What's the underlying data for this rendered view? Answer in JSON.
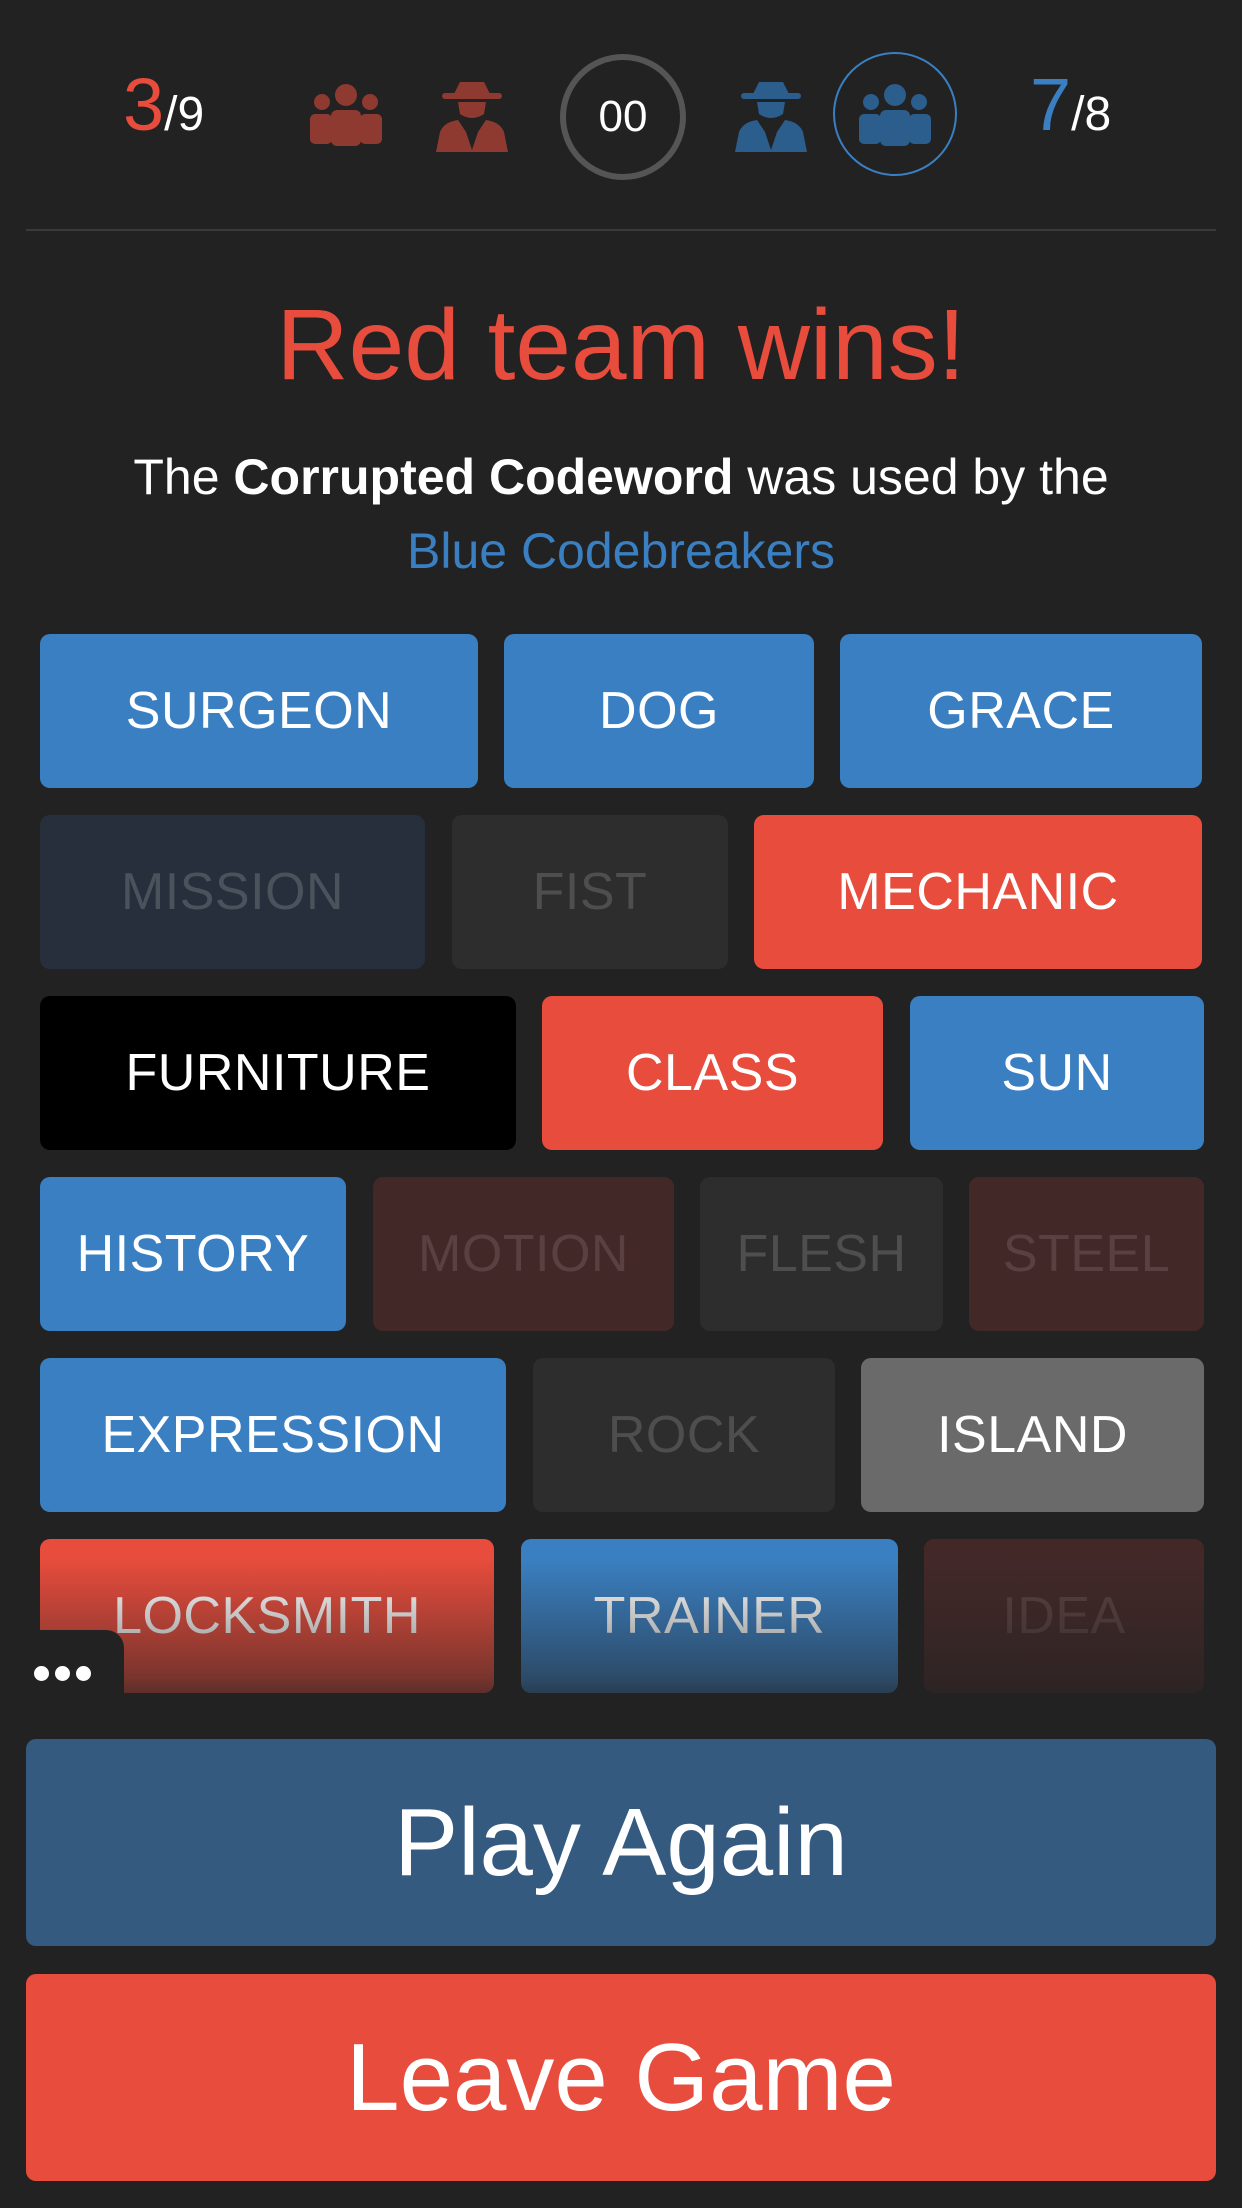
{
  "header": {
    "red_score": {
      "value": "3",
      "total": "/9"
    },
    "blue_score": {
      "value": "7",
      "total": "/8"
    },
    "timer": "00"
  },
  "result": {
    "title": "Red team wins!",
    "msg_prefix": "The ",
    "msg_bold": "Corrupted Codeword",
    "msg_middle": " was used by the",
    "msg_team": "Blue Codebreakers"
  },
  "board": {
    "cards": [
      {
        "word": "SURGEON",
        "team": "blue",
        "revealed": true
      },
      {
        "word": "DOG",
        "team": "blue",
        "revealed": true
      },
      {
        "word": "GRACE",
        "team": "blue",
        "revealed": true
      },
      {
        "word": "MISSION",
        "team": "blue",
        "revealed": false
      },
      {
        "word": "FIST",
        "team": "neutral",
        "revealed": false
      },
      {
        "word": "MECHANIC",
        "team": "red",
        "revealed": true
      },
      {
        "word": "FURNITURE",
        "team": "black",
        "revealed": true
      },
      {
        "word": "CLASS",
        "team": "red",
        "revealed": true
      },
      {
        "word": "SUN",
        "team": "blue",
        "revealed": true
      },
      {
        "word": "HISTORY",
        "team": "blue",
        "revealed": true
      },
      {
        "word": "MOTION",
        "team": "red",
        "revealed": false
      },
      {
        "word": "FLESH",
        "team": "neutral",
        "revealed": false
      },
      {
        "word": "STEEL",
        "team": "red",
        "revealed": false
      },
      {
        "word": "EXPRESSION",
        "team": "blue",
        "revealed": true
      },
      {
        "word": "ROCK",
        "team": "neutral",
        "revealed": false
      },
      {
        "word": "ISLAND",
        "team": "neutral",
        "revealed": true
      },
      {
        "word": "LOCKSMITH",
        "team": "red",
        "revealed": true
      },
      {
        "word": "TRAINER",
        "team": "blue",
        "revealed": true
      },
      {
        "word": "IDEA",
        "team": "red",
        "revealed": false
      }
    ]
  },
  "buttons": {
    "play_again": "Play Again",
    "leave_game": "Leave Game"
  },
  "colors": {
    "red": "#e74c3c",
    "blue": "#3a7fc1",
    "background": "#222222",
    "play_button": "#355a80"
  },
  "icons": [
    "red-team-icon",
    "red-spymaster-icon",
    "blue-spymaster-icon",
    "blue-team-icon",
    "more-options-icon"
  ]
}
